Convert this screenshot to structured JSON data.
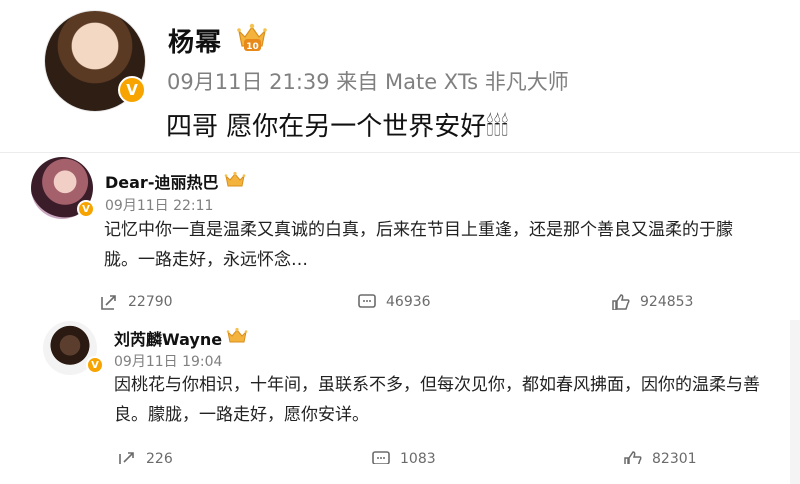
{
  "post1": {
    "username": "杨幂",
    "level_badge": "10",
    "verified_badge": "V",
    "meta": "09月11日 21:39  来自 Mate XTs 非凡大师",
    "content": "四哥 愿你在另一个世界安好🕯🕯🕯"
  },
  "comment1": {
    "username": "Dear-迪丽热巴",
    "verified_badge": "V",
    "time": "09月11日 22:11",
    "content": "记忆中你一直是温柔又真诚的白真，后来在节目上重逢，还是那个善良又温柔的于朦胧。一路走好，永远怀念…",
    "repost_count": "22790",
    "comment_count": "46936",
    "like_count": "924853"
  },
  "comment2": {
    "username": "刘芮麟Wayne",
    "verified_badge": "V",
    "time": "09月11日 19:04",
    "content": "因桃花与你相识，十年间，虽联系不多，但每次见你，都如春风拂面，因你的温柔与善良。朦胧，一路走好，愿你安详。",
    "repost_count": "226",
    "comment_count": "1083",
    "like_count": "82301"
  },
  "colors": {
    "verified": "#f7a400",
    "meta_text": "#808080",
    "action_text": "#6b6b6b"
  },
  "icons": [
    "crown-badge-icon",
    "verified-v-icon",
    "repost-icon",
    "comment-icon",
    "like-icon",
    "candle-emoji"
  ]
}
